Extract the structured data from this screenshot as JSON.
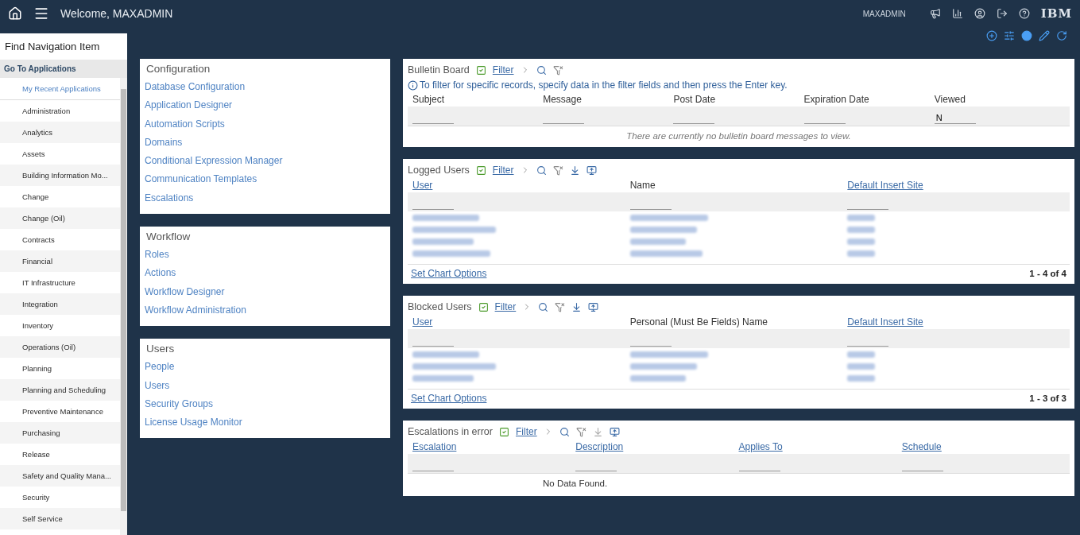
{
  "header": {
    "welcome": "Welcome, MAXADMIN",
    "user": "MAXADMIN",
    "brand": "IBM"
  },
  "sidebar": {
    "title": "Find Navigation Item",
    "section": "Go To Applications",
    "items": [
      {
        "label": "My Recent Applications",
        "selected": true
      },
      {
        "label": "Administration",
        "selected": false
      },
      {
        "label": "Analytics",
        "selected": false
      },
      {
        "label": "Assets",
        "selected": false
      },
      {
        "label": "Building Information Mo...",
        "selected": false
      },
      {
        "label": "Change",
        "selected": false
      },
      {
        "label": "Change (Oil)",
        "selected": false
      },
      {
        "label": "Contracts",
        "selected": false
      },
      {
        "label": "Financial",
        "selected": false
      },
      {
        "label": "IT Infrastructure",
        "selected": false
      },
      {
        "label": "Integration",
        "selected": false
      },
      {
        "label": "Inventory",
        "selected": false
      },
      {
        "label": "Operations (Oil)",
        "selected": false
      },
      {
        "label": "Planning",
        "selected": false
      },
      {
        "label": "Planning and Scheduling",
        "selected": false
      },
      {
        "label": "Preventive Maintenance",
        "selected": false
      },
      {
        "label": "Purchasing",
        "selected": false
      },
      {
        "label": "Release",
        "selected": false
      },
      {
        "label": "Safety and Quality Mana...",
        "selected": false
      },
      {
        "label": "Security",
        "selected": false
      },
      {
        "label": "Self Service",
        "selected": false
      }
    ]
  },
  "link_groups": [
    {
      "title": "Configuration",
      "links": [
        "Database Configuration",
        "Application Designer",
        "Automation Scripts",
        "Domains",
        "Conditional Expression Manager",
        "Communication Templates",
        "Escalations"
      ]
    },
    {
      "title": "Workflow",
      "links": [
        "Roles",
        "Actions",
        "Workflow Designer",
        "Workflow Administration"
      ]
    },
    {
      "title": "Users",
      "links": [
        "People",
        "Users",
        "Security Groups",
        "License Usage Monitor"
      ]
    }
  ],
  "panels": [
    {
      "title": "Bulletin Board",
      "filter_label": "Filter",
      "tools": [
        {
          "kind": "search",
          "disabled": false
        },
        {
          "kind": "clear_filter",
          "disabled": false
        }
      ],
      "info": "To filter for specific records, specify data in the filter fields and then press the Enter key.",
      "columns": [
        {
          "label": "Subject",
          "sortable": false
        },
        {
          "label": "Message",
          "sortable": false
        },
        {
          "label": "Post Date",
          "sortable": false
        },
        {
          "label": "Expiration Date",
          "sortable": false
        },
        {
          "label": "Viewed",
          "sortable": false,
          "filter_value": "N"
        }
      ],
      "empty": {
        "text": "There are currently no bulletin board messages to view.",
        "kind": "italic"
      }
    },
    {
      "title": "Logged Users",
      "filter_label": "Filter",
      "tools": [
        {
          "kind": "search",
          "disabled": false
        },
        {
          "kind": "clear_filter",
          "disabled": false
        },
        {
          "kind": "download",
          "disabled": false
        },
        {
          "kind": "export",
          "disabled": false
        }
      ],
      "columns": [
        {
          "label": "User",
          "sortable": true
        },
        {
          "label": "Name",
          "sortable": false
        },
        {
          "label": "Default Insert Site",
          "sortable": true
        }
      ],
      "rows": [
        {
          "kind": "redacted"
        },
        {
          "kind": "redacted"
        },
        {
          "kind": "redacted"
        },
        {
          "kind": "redacted"
        }
      ],
      "footer_link": "Set Chart Options",
      "count": "1 - 4 of 4"
    },
    {
      "title": "Blocked Users",
      "filter_label": "Filter",
      "tools": [
        {
          "kind": "search",
          "disabled": false
        },
        {
          "kind": "clear_filter",
          "disabled": false
        },
        {
          "kind": "download",
          "disabled": false
        },
        {
          "kind": "export",
          "disabled": false
        }
      ],
      "columns": [
        {
          "label": "User",
          "sortable": true
        },
        {
          "label": "Personal (Must Be Fields) Name",
          "sortable": false
        },
        {
          "label": "Default Insert Site",
          "sortable": true
        }
      ],
      "rows": [
        {
          "kind": "redacted"
        },
        {
          "kind": "redacted"
        },
        {
          "kind": "redacted"
        }
      ],
      "footer_link": "Set Chart Options",
      "count": "1 - 3 of 3"
    },
    {
      "title": "Escalations in error",
      "filter_label": "Filter",
      "tools": [
        {
          "kind": "search",
          "disabled": false
        },
        {
          "kind": "clear_filter",
          "disabled": false
        },
        {
          "kind": "download",
          "disabled": true
        },
        {
          "kind": "export",
          "disabled": false
        }
      ],
      "columns": [
        {
          "label": "Escalation",
          "sortable": true
        },
        {
          "label": "Description",
          "sortable": true
        },
        {
          "label": "Applies To",
          "sortable": true
        },
        {
          "label": "Schedule",
          "sortable": true
        }
      ],
      "empty": {
        "text": "No Data Found.",
        "kind": "plain"
      }
    }
  ]
}
